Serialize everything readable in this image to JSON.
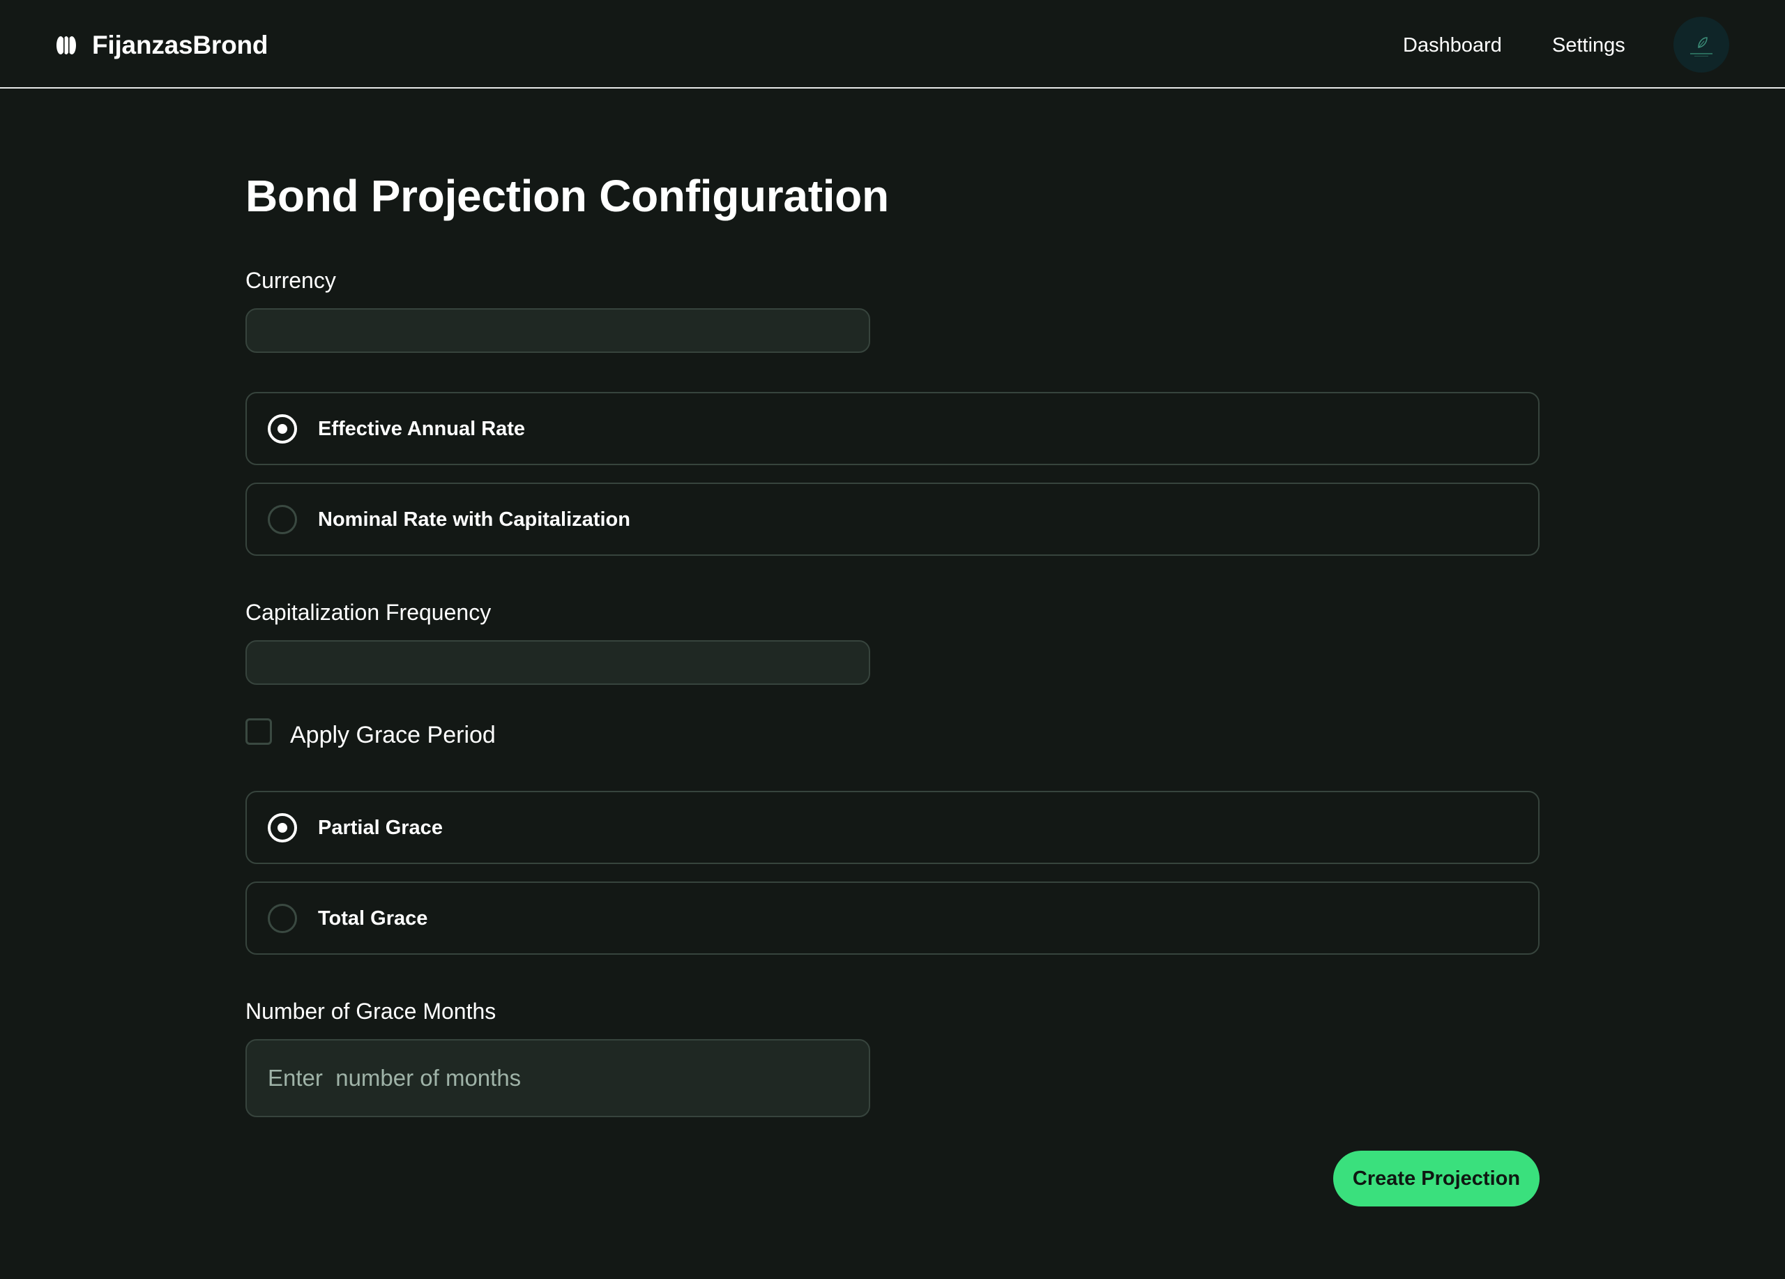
{
  "app": {
    "brand_name": "FijanzasBrond",
    "accent_color": "#3ae07d",
    "background_color": "#131815"
  },
  "header": {
    "nav": [
      {
        "label": "Dashboard"
      },
      {
        "label": "Settings"
      }
    ],
    "avatar_icon": "leaf-avatar-icon"
  },
  "form": {
    "title": "Bond Projection Configuration",
    "currency": {
      "label": "Currency",
      "value": ""
    },
    "rate_type": {
      "options": [
        {
          "label": "Effective Annual Rate",
          "checked": true
        },
        {
          "label": "Nominal Rate with Capitalization",
          "checked": false
        }
      ]
    },
    "capitalization_frequency": {
      "label": "Capitalization Frequency",
      "value": ""
    },
    "grace": {
      "checkbox_label": "Apply Grace Period",
      "checked": false,
      "options": [
        {
          "label": "Partial Grace",
          "checked": true
        },
        {
          "label": "Total Grace",
          "checked": false
        }
      ]
    },
    "grace_months": {
      "label": "Number of Grace Months",
      "placeholder": "Enter  number of months",
      "value": ""
    },
    "submit_label": "Create Projection"
  }
}
